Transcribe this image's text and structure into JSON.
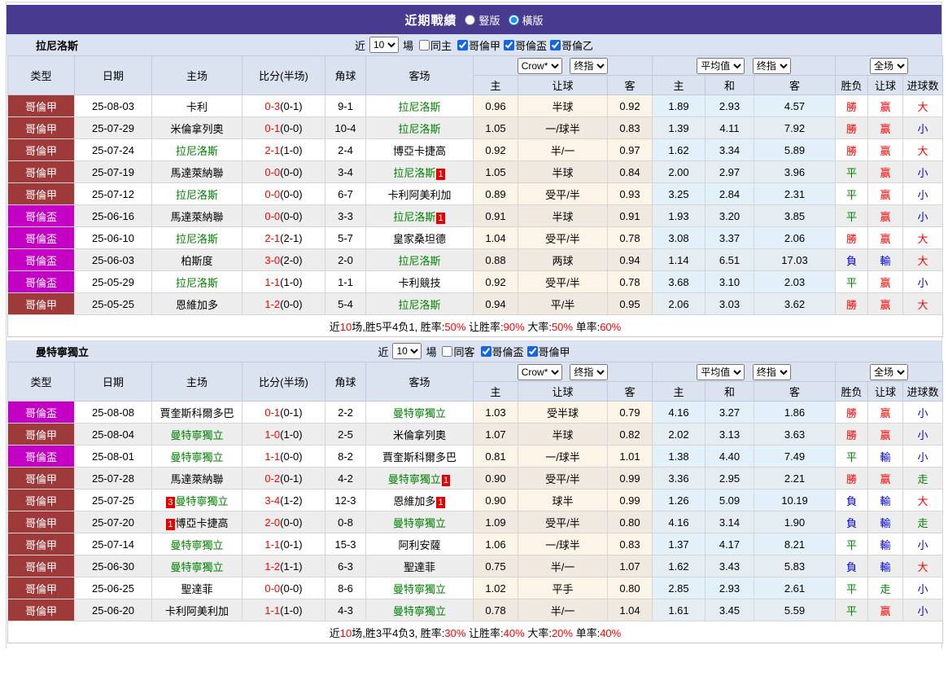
{
  "header": {
    "title": "近期戰績",
    "radio_vertical": "豎版",
    "radio_horizontal": "橫版",
    "accent_color": "#483a8f"
  },
  "league_colors": {
    "哥倫甲": "#9e3a3a",
    "哥倫盃": "#c400c4"
  },
  "result_colors": {
    "r": "#ff0000",
    "g": "#008000",
    "b": "#0000e8"
  },
  "tables": [
    {
      "team": "拉尼洛斯",
      "filter": {
        "near": "近",
        "count": "10",
        "games": "場",
        "same": "同主",
        "same_checked": false,
        "leagues": [
          {
            "label": "哥倫甲",
            "checked": true
          },
          {
            "label": "哥倫盃",
            "checked": true
          },
          {
            "label": "哥倫乙",
            "checked": true
          }
        ]
      },
      "selects": [
        "Crow*",
        "终指",
        "平均值",
        "终指",
        "全场"
      ],
      "columns": [
        "类型",
        "日期",
        "主场",
        "比分(半场)",
        "角球",
        "客场"
      ],
      "sub_columns": [
        "主",
        "让球",
        "客",
        "主",
        "和",
        "客",
        "胜负",
        "让球",
        "进球数"
      ],
      "rows": [
        {
          "lg": "哥倫甲",
          "date": "25-08-03",
          "home": "卡利",
          "hg": false,
          "hb": null,
          "score": "0-3",
          "half": "(0-1)",
          "corner": "9-1",
          "away": "拉尼洛斯",
          "ag": true,
          "ab": null,
          "o1": "0.96",
          "line": "半球",
          "o2": "0.92",
          "a1": "1.89",
          "a2": "2.93",
          "a3": "4.57",
          "res": [
            [
              "勝",
              "r"
            ],
            [
              "赢",
              "r"
            ],
            [
              "大",
              "r"
            ]
          ]
        },
        {
          "lg": "哥倫甲",
          "date": "25-07-29",
          "home": "米倫拿列奧",
          "hg": false,
          "hb": null,
          "score": "0-1",
          "half": "(0-0)",
          "corner": "10-4",
          "away": "拉尼洛斯",
          "ag": true,
          "ab": null,
          "o1": "1.05",
          "line": "一/球半",
          "o2": "0.83",
          "a1": "1.39",
          "a2": "4.11",
          "a3": "7.92",
          "res": [
            [
              "勝",
              "r"
            ],
            [
              "赢",
              "r"
            ],
            [
              "小",
              "b"
            ]
          ]
        },
        {
          "lg": "哥倫甲",
          "date": "25-07-24",
          "home": "拉尼洛斯",
          "hg": true,
          "hb": null,
          "score": "2-1",
          "half": "(1-0)",
          "corner": "2-4",
          "away": "博亞卡捷高",
          "ag": false,
          "ab": null,
          "o1": "0.92",
          "line": "半/一",
          "o2": "0.97",
          "a1": "1.62",
          "a2": "3.34",
          "a3": "5.89",
          "res": [
            [
              "勝",
              "r"
            ],
            [
              "赢",
              "r"
            ],
            [
              "大",
              "r"
            ]
          ]
        },
        {
          "lg": "哥倫甲",
          "date": "25-07-19",
          "home": "馬達萊納聯",
          "hg": false,
          "hb": null,
          "score": "0-0",
          "half": "(0-0)",
          "corner": "3-4",
          "away": "拉尼洛斯",
          "ag": true,
          "ab": "1",
          "o1": "1.05",
          "line": "半球",
          "o2": "0.84",
          "a1": "2.00",
          "a2": "2.97",
          "a3": "3.96",
          "res": [
            [
              "平",
              "g"
            ],
            [
              "赢",
              "r"
            ],
            [
              "小",
              "b"
            ]
          ]
        },
        {
          "lg": "哥倫甲",
          "date": "25-07-12",
          "home": "拉尼洛斯",
          "hg": true,
          "hb": null,
          "score": "0-0",
          "half": "(0-0)",
          "corner": "6-7",
          "away": "卡利阿美利加",
          "ag": false,
          "ab": null,
          "o1": "0.89",
          "line": "受平/半",
          "o2": "0.93",
          "a1": "3.25",
          "a2": "2.84",
          "a3": "2.31",
          "res": [
            [
              "平",
              "g"
            ],
            [
              "赢",
              "r"
            ],
            [
              "小",
              "b"
            ]
          ]
        },
        {
          "lg": "哥倫盃",
          "date": "25-06-16",
          "home": "馬達萊納聯",
          "hg": false,
          "hb": null,
          "score": "0-0",
          "half": "(0-0)",
          "corner": "3-3",
          "away": "拉尼洛斯",
          "ag": true,
          "ab": "1",
          "o1": "0.91",
          "line": "半球",
          "o2": "0.91",
          "a1": "1.93",
          "a2": "3.20",
          "a3": "3.85",
          "res": [
            [
              "平",
              "g"
            ],
            [
              "赢",
              "r"
            ],
            [
              "小",
              "b"
            ]
          ]
        },
        {
          "lg": "哥倫盃",
          "date": "25-06-10",
          "home": "拉尼洛斯",
          "hg": true,
          "hb": null,
          "score": "2-1",
          "half": "(2-1)",
          "corner": "5-7",
          "away": "皇家桑坦德",
          "ag": false,
          "ab": null,
          "o1": "1.04",
          "line": "受平/半",
          "o2": "0.78",
          "a1": "3.08",
          "a2": "3.37",
          "a3": "2.06",
          "res": [
            [
              "勝",
              "r"
            ],
            [
              "赢",
              "r"
            ],
            [
              "大",
              "r"
            ]
          ]
        },
        {
          "lg": "哥倫盃",
          "date": "25-06-03",
          "home": "柏斯度",
          "hg": false,
          "hb": null,
          "score": "3-0",
          "half": "(2-0)",
          "corner": "2-0",
          "away": "拉尼洛斯",
          "ag": true,
          "ab": null,
          "o1": "0.88",
          "line": "两球",
          "o2": "0.94",
          "a1": "1.14",
          "a2": "6.51",
          "a3": "17.03",
          "res": [
            [
              "負",
              "b"
            ],
            [
              "輸",
              "b"
            ],
            [
              "大",
              "r"
            ]
          ]
        },
        {
          "lg": "哥倫盃",
          "date": "25-05-29",
          "home": "拉尼洛斯",
          "hg": true,
          "hb": null,
          "score": "1-1",
          "half": "(1-0)",
          "corner": "1-1",
          "away": "卡利競技",
          "ag": false,
          "ab": null,
          "o1": "0.92",
          "line": "受平/半",
          "o2": "0.78",
          "a1": "3.68",
          "a2": "3.10",
          "a3": "2.03",
          "res": [
            [
              "平",
              "g"
            ],
            [
              "赢",
              "r"
            ],
            [
              "小",
              "b"
            ]
          ]
        },
        {
          "lg": "哥倫甲",
          "date": "25-05-25",
          "home": "恩維加多",
          "hg": false,
          "hb": null,
          "score": "1-2",
          "half": "(0-0)",
          "corner": "5-4",
          "away": "拉尼洛斯",
          "ag": true,
          "ab": null,
          "o1": "0.94",
          "line": "平/半",
          "o2": "0.95",
          "a1": "2.06",
          "a2": "3.03",
          "a3": "3.62",
          "res": [
            [
              "勝",
              "r"
            ],
            [
              "赢",
              "r"
            ],
            [
              "大",
              "r"
            ]
          ]
        }
      ],
      "summary": [
        {
          "t": "近",
          "c": "k"
        },
        {
          "t": "10",
          "c": "r"
        },
        {
          "t": "场,胜5平4负1, 胜率:",
          "c": "k"
        },
        {
          "t": "50%",
          "c": "r"
        },
        {
          "t": " 让胜率:",
          "c": "k"
        },
        {
          "t": "90%",
          "c": "r"
        },
        {
          "t": " 大率:",
          "c": "k"
        },
        {
          "t": "50%",
          "c": "r"
        },
        {
          "t": " 单率:",
          "c": "k"
        },
        {
          "t": "60%",
          "c": "r"
        }
      ]
    },
    {
      "team": "曼特寧獨立",
      "filter": {
        "near": "近",
        "count": "10",
        "games": "場",
        "same": "同客",
        "same_checked": false,
        "leagues": [
          {
            "label": "哥倫盃",
            "checked": true
          },
          {
            "label": "哥倫甲",
            "checked": true
          }
        ]
      },
      "selects": [
        "Crow*",
        "终指",
        "平均值",
        "终指",
        "全场"
      ],
      "columns": [
        "类型",
        "日期",
        "主场",
        "比分(半场)",
        "角球",
        "客场"
      ],
      "sub_columns": [
        "主",
        "让球",
        "客",
        "主",
        "和",
        "客",
        "胜负",
        "让球",
        "进球数"
      ],
      "rows": [
        {
          "lg": "哥倫盃",
          "date": "25-08-08",
          "home": "賈奎斯科爾多巴",
          "hg": false,
          "hb": null,
          "score": "0-1",
          "half": "(0-1)",
          "corner": "2-2",
          "away": "曼特寧獨立",
          "ag": true,
          "ab": null,
          "o1": "1.03",
          "line": "受半球",
          "o2": "0.79",
          "a1": "4.16",
          "a2": "3.27",
          "a3": "1.86",
          "res": [
            [
              "勝",
              "r"
            ],
            [
              "赢",
              "r"
            ],
            [
              "小",
              "b"
            ]
          ]
        },
        {
          "lg": "哥倫甲",
          "date": "25-08-04",
          "home": "曼特寧獨立",
          "hg": true,
          "hb": null,
          "score": "1-0",
          "half": "(1-0)",
          "corner": "2-5",
          "away": "米倫拿列奧",
          "ag": false,
          "ab": null,
          "o1": "1.07",
          "line": "半球",
          "o2": "0.82",
          "a1": "2.02",
          "a2": "3.13",
          "a3": "3.63",
          "res": [
            [
              "勝",
              "r"
            ],
            [
              "赢",
              "r"
            ],
            [
              "小",
              "b"
            ]
          ]
        },
        {
          "lg": "哥倫盃",
          "date": "25-08-01",
          "home": "曼特寧獨立",
          "hg": true,
          "hb": null,
          "score": "1-1",
          "half": "(0-0)",
          "corner": "8-2",
          "away": "賈奎斯科爾多巴",
          "ag": false,
          "ab": null,
          "o1": "0.81",
          "line": "一/球半",
          "o2": "1.01",
          "a1": "1.38",
          "a2": "4.40",
          "a3": "7.49",
          "res": [
            [
              "平",
              "g"
            ],
            [
              "輸",
              "b"
            ],
            [
              "小",
              "b"
            ]
          ]
        },
        {
          "lg": "哥倫甲",
          "date": "25-07-28",
          "home": "馬達萊納聯",
          "hg": false,
          "hb": null,
          "score": "0-2",
          "half": "(0-1)",
          "corner": "4-2",
          "away": "曼特寧獨立",
          "ag": true,
          "ab": "1",
          "o1": "0.90",
          "line": "受平/半",
          "o2": "0.99",
          "a1": "3.36",
          "a2": "2.95",
          "a3": "2.21",
          "res": [
            [
              "勝",
              "r"
            ],
            [
              "赢",
              "r"
            ],
            [
              "走",
              "g"
            ]
          ]
        },
        {
          "lg": "哥倫甲",
          "date": "25-07-25",
          "home": "曼特寧獨立",
          "hg": true,
          "hb": "3",
          "score": "3-4",
          "half": "(1-2)",
          "corner": "12-3",
          "away": "恩維加多",
          "ag": false,
          "ab": "1",
          "o1": "0.90",
          "line": "球半",
          "o2": "0.99",
          "a1": "1.26",
          "a2": "5.09",
          "a3": "10.19",
          "res": [
            [
              "負",
              "b"
            ],
            [
              "輸",
              "b"
            ],
            [
              "大",
              "r"
            ]
          ]
        },
        {
          "lg": "哥倫甲",
          "date": "25-07-20",
          "home": "博亞卡捷高",
          "hg": false,
          "hb": "1",
          "score": "2-0",
          "half": "(0-0)",
          "corner": "0-8",
          "away": "曼特寧獨立",
          "ag": true,
          "ab": null,
          "o1": "1.09",
          "line": "受平/半",
          "o2": "0.80",
          "a1": "4.16",
          "a2": "3.14",
          "a3": "1.90",
          "res": [
            [
              "負",
              "b"
            ],
            [
              "輸",
              "b"
            ],
            [
              "走",
              "g"
            ]
          ]
        },
        {
          "lg": "哥倫甲",
          "date": "25-07-14",
          "home": "曼特寧獨立",
          "hg": true,
          "hb": null,
          "score": "1-1",
          "half": "(0-1)",
          "corner": "15-3",
          "away": "阿利安薩",
          "ag": false,
          "ab": null,
          "o1": "1.06",
          "line": "一/球半",
          "o2": "0.83",
          "a1": "1.37",
          "a2": "4.17",
          "a3": "8.21",
          "res": [
            [
              "平",
              "g"
            ],
            [
              "輸",
              "b"
            ],
            [
              "小",
              "b"
            ]
          ]
        },
        {
          "lg": "哥倫甲",
          "date": "25-06-30",
          "home": "曼特寧獨立",
          "hg": true,
          "hb": null,
          "score": "1-2",
          "half": "(1-1)",
          "corner": "6-3",
          "away": "聖達菲",
          "ag": false,
          "ab": null,
          "o1": "0.75",
          "line": "半/一",
          "o2": "1.07",
          "a1": "1.62",
          "a2": "3.43",
          "a3": "5.83",
          "res": [
            [
              "負",
              "b"
            ],
            [
              "輸",
              "b"
            ],
            [
              "大",
              "r"
            ]
          ]
        },
        {
          "lg": "哥倫甲",
          "date": "25-06-25",
          "home": "聖達菲",
          "hg": false,
          "hb": null,
          "score": "0-0",
          "half": "(0-0)",
          "corner": "8-6",
          "away": "曼特寧獨立",
          "ag": true,
          "ab": null,
          "o1": "1.02",
          "line": "平手",
          "o2": "0.80",
          "a1": "2.85",
          "a2": "2.93",
          "a3": "2.61",
          "res": [
            [
              "平",
              "g"
            ],
            [
              "走",
              "g"
            ],
            [
              "小",
              "b"
            ]
          ]
        },
        {
          "lg": "哥倫甲",
          "date": "25-06-20",
          "home": "卡利阿美利加",
          "hg": false,
          "hb": null,
          "score": "1-1",
          "half": "(1-0)",
          "corner": "4-3",
          "away": "曼特寧獨立",
          "ag": true,
          "ab": null,
          "o1": "0.78",
          "line": "半/一",
          "o2": "1.04",
          "a1": "1.61",
          "a2": "3.45",
          "a3": "5.59",
          "res": [
            [
              "平",
              "g"
            ],
            [
              "赢",
              "r"
            ],
            [
              "小",
              "b"
            ]
          ]
        }
      ],
      "summary": [
        {
          "t": "近",
          "c": "k"
        },
        {
          "t": "10",
          "c": "r"
        },
        {
          "t": "场,胜3平4负3, 胜率:",
          "c": "k"
        },
        {
          "t": "30%",
          "c": "r"
        },
        {
          "t": " 让胜率:",
          "c": "k"
        },
        {
          "t": "40%",
          "c": "r"
        },
        {
          "t": " 大率:",
          "c": "k"
        },
        {
          "t": "20%",
          "c": "r"
        },
        {
          "t": " 单率:",
          "c": "k"
        },
        {
          "t": "40%",
          "c": "r"
        }
      ]
    }
  ]
}
